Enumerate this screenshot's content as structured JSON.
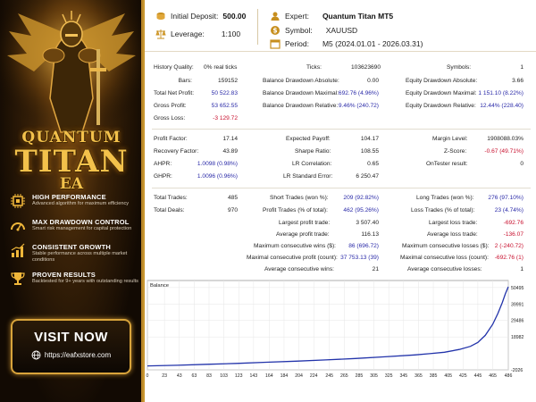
{
  "brand": {
    "line1": "QUANTUM",
    "line2": "TITAN",
    "line3": "EA"
  },
  "features": [
    {
      "icon": "chip-icon",
      "title": "HIGH PERFORMANCE",
      "desc": "Advanced algorithm for maximum efficiency"
    },
    {
      "icon": "gauge-icon",
      "title": "MAX DRAWDOWN CONTROL",
      "desc": "Smart risk management for capital protection"
    },
    {
      "icon": "growth-chart-icon",
      "title": "CONSISTENT GROWTH",
      "desc": "Stable performance across multiple market conditions"
    },
    {
      "icon": "trophy-icon",
      "title": "PROVEN RESULTS",
      "desc": "Backtested for 9+ years with outstanding results"
    }
  ],
  "visit": {
    "label": "VISIT NOW",
    "url": "https://eafxstore.com"
  },
  "header": {
    "deposit_label": "Initial Deposit:",
    "deposit_value": "500.00",
    "leverage_label": "Leverage:",
    "leverage_value": "1:100",
    "expert_label": "Expert:",
    "expert_value": "Quantum Titan MT5",
    "symbol_label": "Symbol:",
    "symbol_value": "XAUUSD",
    "period_label": "Period:",
    "period_value": "M5 (2024.01.01 - 2026.03.31)"
  },
  "stats1": {
    "history_quality_label": "History Quality:",
    "history_quality": "0% real ticks",
    "bars_label": "Bars:",
    "bars": "159152",
    "net_profit_label": "Total Net Profit:",
    "net_profit": "50 522.83",
    "gross_profit_label": "Gross Profit:",
    "gross_profit": "53 652.55",
    "gross_loss_label": "Gross Loss:",
    "gross_loss": "-3 129.72",
    "ticks_label": "Ticks:",
    "ticks": "103623690",
    "bda_label": "Balance Drawdown Absolute:",
    "bda": "0.00",
    "bdm_label": "Balance Drawdown Maximal:",
    "bdm": "692.76 (4.96%)",
    "bdr_label": "Balance Drawdown Relative:",
    "bdr": "9.46% (240.72)",
    "symbols_label": "Symbols:",
    "symbols": "1",
    "eda_label": "Equity Drawdown Absolute:",
    "eda": "3.66",
    "edm_label": "Equity Drawdown Maximal:",
    "edm": "1 151.10 (8.22%)",
    "edr_label": "Equity Drawdown Relative:",
    "edr": "12.44% (228.40)"
  },
  "stats2": {
    "pf_label": "Profit Factor:",
    "pf": "17.14",
    "rf_label": "Recovery Factor:",
    "rf": "43.89",
    "ahpr_label": "AHPR:",
    "ahpr": "1.0098 (0.98%)",
    "ghpr_label": "GHPR:",
    "ghpr": "1.0096 (0.96%)",
    "ep_label": "Expected Payoff:",
    "ep": "104.17",
    "sr_label": "Sharpe Ratio:",
    "sr": "108.55",
    "lrc_label": "LR Correlation:",
    "lrc": "0.65",
    "lrse_label": "LR Standard Error:",
    "lrse": "6 250.47",
    "ml_label": "Margin Level:",
    "ml": "1908088.03%",
    "zs_label": "Z-Score:",
    "zs": "-0.67 (49.71%)",
    "otr_label": "OnTester result:",
    "otr": "0"
  },
  "stats3": {
    "tt_label": "Total Trades:",
    "tt": "485",
    "td_label": "Total Deals:",
    "td": "970",
    "st_label": "Short Trades (won %):",
    "st": "209 (92.82%)",
    "pt_label": "Profit Trades (% of total):",
    "pt": "462 (95.26%)",
    "lpt_label": "Largest profit trade:",
    "lpt": "3 507.40",
    "apt_label": "Average profit trade:",
    "apt": "116.13",
    "mcw_label": "Maximum consecutive wins ($):",
    "mcw": "86 (696.72)",
    "mcp_label": "Maximal consecutive profit (count):",
    "mcp": "37 753.13 (39)",
    "acw_label": "Average consecutive wins:",
    "acw": "21",
    "lt_label": "Long Trades (won %):",
    "lt": "276 (97.10%)",
    "ltr_label": "Loss Trades (% of total):",
    "ltr": "23 (4.74%)",
    "llt_label": "Largest loss trade:",
    "llt": "-692.76",
    "alt_label": "Average loss trade:",
    "alt": "-136.07",
    "mcl_label": "Maximum consecutive losses ($):",
    "mcl": "2 (-240.72)",
    "mclc_label": "Maximal consecutive loss (count):",
    "mclc": "-692.76 (1)",
    "acl_label": "Average consecutive losses:",
    "acl": "1"
  },
  "chart_data": {
    "type": "line",
    "title": "Balance",
    "x_ticks": [
      0,
      23,
      43,
      63,
      83,
      103,
      123,
      143,
      164,
      184,
      204,
      224,
      245,
      265,
      285,
      305,
      325,
      345,
      365,
      385,
      405,
      425,
      445,
      465,
      486
    ],
    "y_ticks": [
      -2026,
      18982,
      29486,
      39991,
      50495
    ],
    "xlim": [
      0,
      486
    ],
    "ylim": [
      -2026,
      55000
    ],
    "series": [
      {
        "name": "Balance",
        "color": "#2233aa",
        "x": [
          0,
          40,
          80,
          120,
          160,
          200,
          240,
          280,
          320,
          360,
          380,
          400,
          420,
          435,
          445,
          455,
          465,
          472,
          478,
          482,
          486
        ],
        "y": [
          500,
          900,
          1500,
          2100,
          2800,
          3500,
          4300,
          5200,
          6300,
          7500,
          8300,
          9200,
          11000,
          13000,
          15500,
          20000,
          27000,
          34000,
          41000,
          46500,
          51023
        ]
      }
    ]
  }
}
